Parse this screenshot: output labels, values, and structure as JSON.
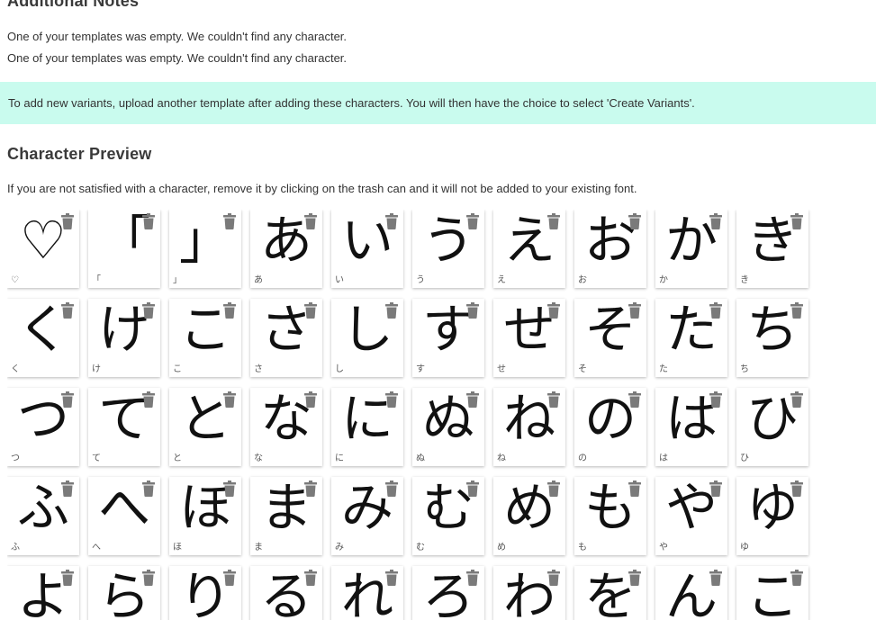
{
  "notes": {
    "heading": "Additional Notes",
    "lines": [
      "One of your templates was empty. We couldn't find any character.",
      "One of your templates was empty. We couldn't find any character."
    ]
  },
  "banner": {
    "text": "To add new variants, upload another template after adding these characters. You will then have the choice to select 'Create Variants'.",
    "color": "#c9fbee"
  },
  "preview": {
    "heading": "Character Preview",
    "description": "If you are not satisfied with a character, remove it by clicking on the trash can and it will not be added to your existing font."
  },
  "characters": [
    {
      "glyph": "♡",
      "label": "♡"
    },
    {
      "glyph": "「",
      "label": "「"
    },
    {
      "glyph": "」",
      "label": "」"
    },
    {
      "glyph": "あ",
      "label": "あ"
    },
    {
      "glyph": "い",
      "label": "い"
    },
    {
      "glyph": "う",
      "label": "う"
    },
    {
      "glyph": "え",
      "label": "え"
    },
    {
      "glyph": "お",
      "label": "お"
    },
    {
      "glyph": "か",
      "label": "か"
    },
    {
      "glyph": "き",
      "label": "き"
    },
    {
      "glyph": "く",
      "label": "く"
    },
    {
      "glyph": "け",
      "label": "け"
    },
    {
      "glyph": "こ",
      "label": "こ"
    },
    {
      "glyph": "さ",
      "label": "さ"
    },
    {
      "glyph": "し",
      "label": "し"
    },
    {
      "glyph": "す",
      "label": "す"
    },
    {
      "glyph": "せ",
      "label": "せ"
    },
    {
      "glyph": "そ",
      "label": "そ"
    },
    {
      "glyph": "た",
      "label": "た"
    },
    {
      "glyph": "ち",
      "label": "ち"
    },
    {
      "glyph": "つ",
      "label": "つ"
    },
    {
      "glyph": "て",
      "label": "て"
    },
    {
      "glyph": "と",
      "label": "と"
    },
    {
      "glyph": "な",
      "label": "な"
    },
    {
      "glyph": "に",
      "label": "に"
    },
    {
      "glyph": "ぬ",
      "label": "ぬ"
    },
    {
      "glyph": "ね",
      "label": "ね"
    },
    {
      "glyph": "の",
      "label": "の"
    },
    {
      "glyph": "は",
      "label": "は"
    },
    {
      "glyph": "ひ",
      "label": "ひ"
    },
    {
      "glyph": "ふ",
      "label": "ふ"
    },
    {
      "glyph": "へ",
      "label": "へ"
    },
    {
      "glyph": "ほ",
      "label": "ほ"
    },
    {
      "glyph": "ま",
      "label": "ま"
    },
    {
      "glyph": "み",
      "label": "み"
    },
    {
      "glyph": "む",
      "label": "む"
    },
    {
      "glyph": "め",
      "label": "め"
    },
    {
      "glyph": "も",
      "label": "も"
    },
    {
      "glyph": "や",
      "label": "や"
    },
    {
      "glyph": "ゆ",
      "label": "ゆ"
    },
    {
      "glyph": "よ",
      "label": "よ"
    },
    {
      "glyph": "ら",
      "label": "ら"
    },
    {
      "glyph": "り",
      "label": "り"
    },
    {
      "glyph": "る",
      "label": "る"
    },
    {
      "glyph": "れ",
      "label": "れ"
    },
    {
      "glyph": "ろ",
      "label": "ろ"
    },
    {
      "glyph": "わ",
      "label": "わ"
    },
    {
      "glyph": "を",
      "label": "を"
    },
    {
      "glyph": "ん",
      "label": "ん"
    },
    {
      "glyph": "こ",
      "label": "こ"
    }
  ],
  "icons": {
    "delete": "trash-can-icon",
    "trash_color": "#7a7a7a"
  }
}
